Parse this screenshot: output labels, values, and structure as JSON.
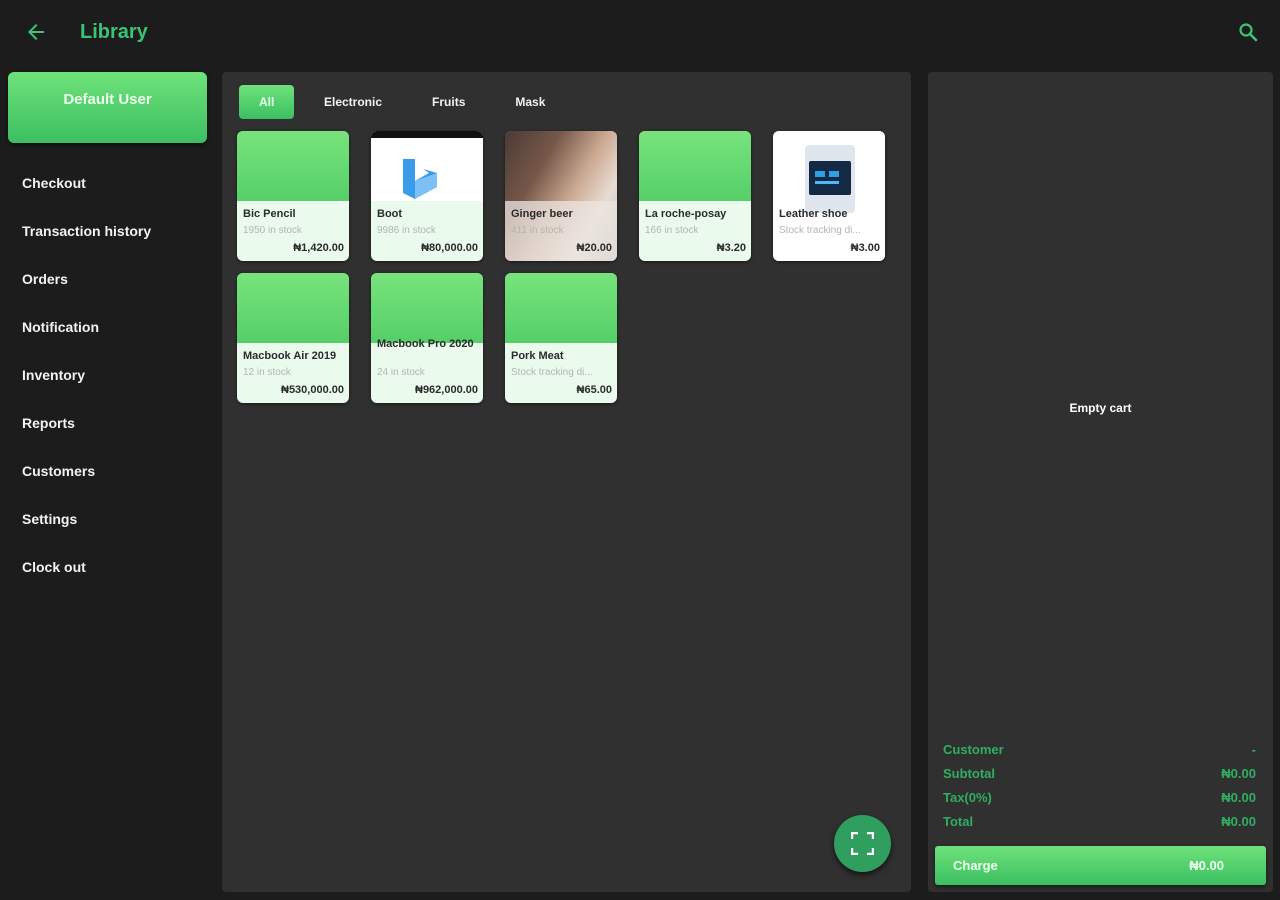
{
  "header": {
    "title": "Library",
    "back_icon": "arrow-left-icon",
    "search_icon": "search-icon",
    "accent": "#3cc476"
  },
  "sidebar": {
    "user_label": "Default User",
    "items": [
      {
        "label": "Checkout"
      },
      {
        "label": "Transaction history"
      },
      {
        "label": "Orders"
      },
      {
        "label": "Notification"
      },
      {
        "label": "Inventory"
      },
      {
        "label": "Reports"
      },
      {
        "label": "Customers"
      },
      {
        "label": "Settings"
      },
      {
        "label": "Clock out"
      }
    ]
  },
  "library": {
    "tabs": [
      {
        "label": "All",
        "active": true
      },
      {
        "label": "Electronic",
        "active": false
      },
      {
        "label": "Fruits",
        "active": false
      },
      {
        "label": "Mask",
        "active": false
      }
    ],
    "products": [
      {
        "name": "Bic Pencil",
        "stock": "1950 in stock",
        "price": "₦1,420.00",
        "thumb": "green"
      },
      {
        "name": "Boot",
        "stock": "9986 in stock",
        "price": "₦80,000.00",
        "thumb": "app-logo-image"
      },
      {
        "name": "Ginger beer",
        "stock": "411 in stock",
        "price": "₦20.00",
        "thumb": "photo-image"
      },
      {
        "name": "La roche-posay",
        "stock": "166 in stock",
        "price": "₦3.20",
        "thumb": "green"
      },
      {
        "name": "Leather shoe",
        "stock": "Stock tracking di...",
        "price": "₦3.00",
        "thumb": "device-image"
      },
      {
        "name": "Macbook Air 2019",
        "stock": "12 in stock",
        "price": "₦530,000.00",
        "thumb": "green"
      },
      {
        "name": "Macbook Pro 2020",
        "stock": "24 in stock",
        "price": "₦962,000.00",
        "thumb": "green"
      },
      {
        "name": "Pork Meat",
        "stock": "Stock tracking di...",
        "price": "₦65.00",
        "thumb": "green"
      }
    ],
    "fab_icon": "scan-frame-icon"
  },
  "cart": {
    "empty_text": "Empty cart",
    "summary": [
      {
        "label": "Customer",
        "value": "-"
      },
      {
        "label": "Subtotal",
        "value": "₦0.00"
      },
      {
        "label": "Tax(0%)",
        "value": "₦0.00"
      },
      {
        "label": "Total",
        "value": "₦0.00"
      }
    ],
    "charge_label": "Charge",
    "charge_total": "₦0.00"
  }
}
